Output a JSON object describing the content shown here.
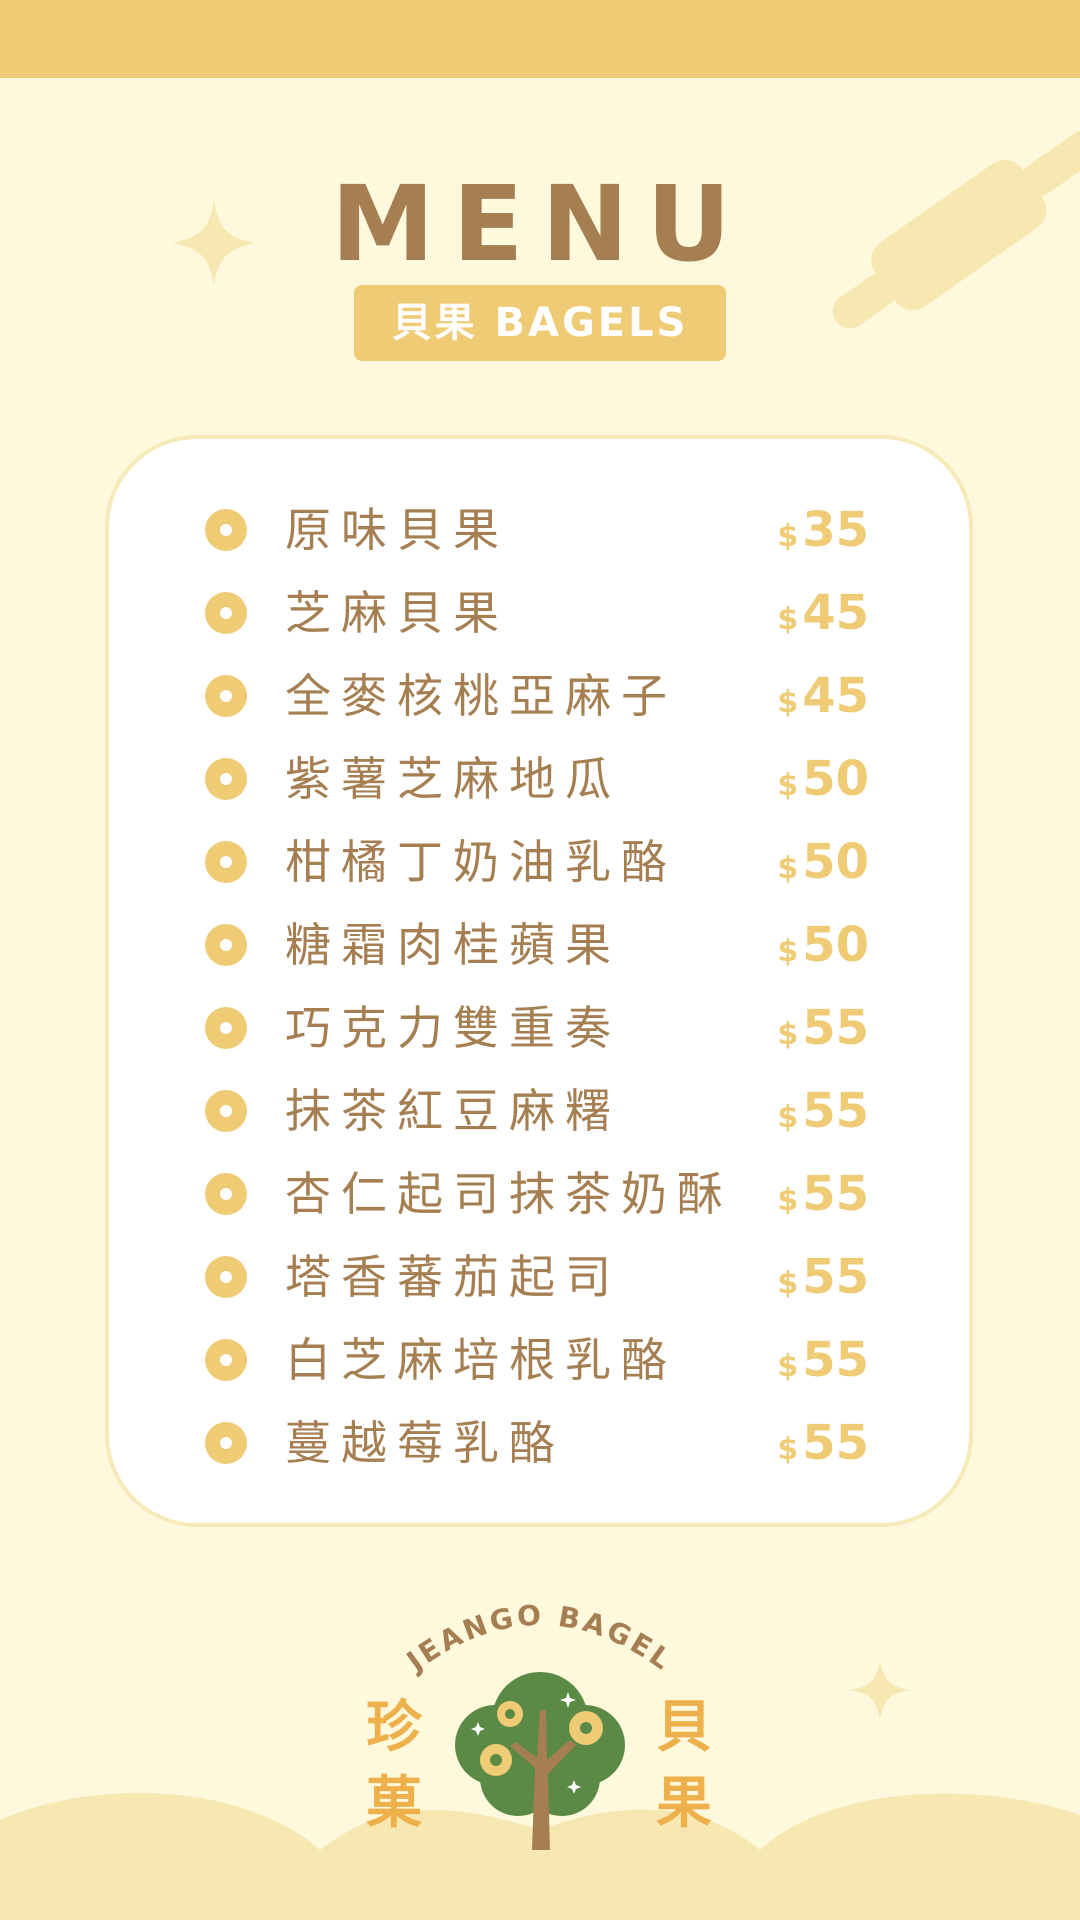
{
  "title": "MENU",
  "subtitle": "貝果 BAGELS",
  "colors": {
    "background": "#fef8dd",
    "accent": "#eecb74",
    "text": "#a57f52",
    "card": "#ffffff",
    "tree_green": "#5a8a45",
    "brand_orange": "#edb04a"
  },
  "items": [
    {
      "name": "原味貝果",
      "currency": "$",
      "price": "35"
    },
    {
      "name": "芝麻貝果",
      "currency": "$",
      "price": "45"
    },
    {
      "name": "全麥核桃亞麻子",
      "currency": "$",
      "price": "45"
    },
    {
      "name": "紫薯芝麻地瓜",
      "currency": "$",
      "price": "50"
    },
    {
      "name": "柑橘丁奶油乳酪",
      "currency": "$",
      "price": "50"
    },
    {
      "name": "糖霜肉桂蘋果",
      "currency": "$",
      "price": "50"
    },
    {
      "name": "巧克力雙重奏",
      "currency": "$",
      "price": "55"
    },
    {
      "name": "抹茶紅豆麻糬",
      "currency": "$",
      "price": "55"
    },
    {
      "name": "杏仁起司抹茶奶酥",
      "currency": "$",
      "price": "55"
    },
    {
      "name": "塔香蕃茄起司",
      "currency": "$",
      "price": "55"
    },
    {
      "name": "白芝麻培根乳酪",
      "currency": "$",
      "price": "55"
    },
    {
      "name": "蔓越莓乳酪",
      "currency": "$",
      "price": "55"
    }
  ],
  "logo": {
    "arc_text": "JEANGO BAGEL",
    "left_chars": [
      "珍",
      "菓"
    ],
    "right_chars": [
      "貝",
      "果"
    ],
    "icon": "bagel-tree-icon"
  },
  "decorations": [
    "sparkle-icon",
    "rolling-pin-icon"
  ]
}
